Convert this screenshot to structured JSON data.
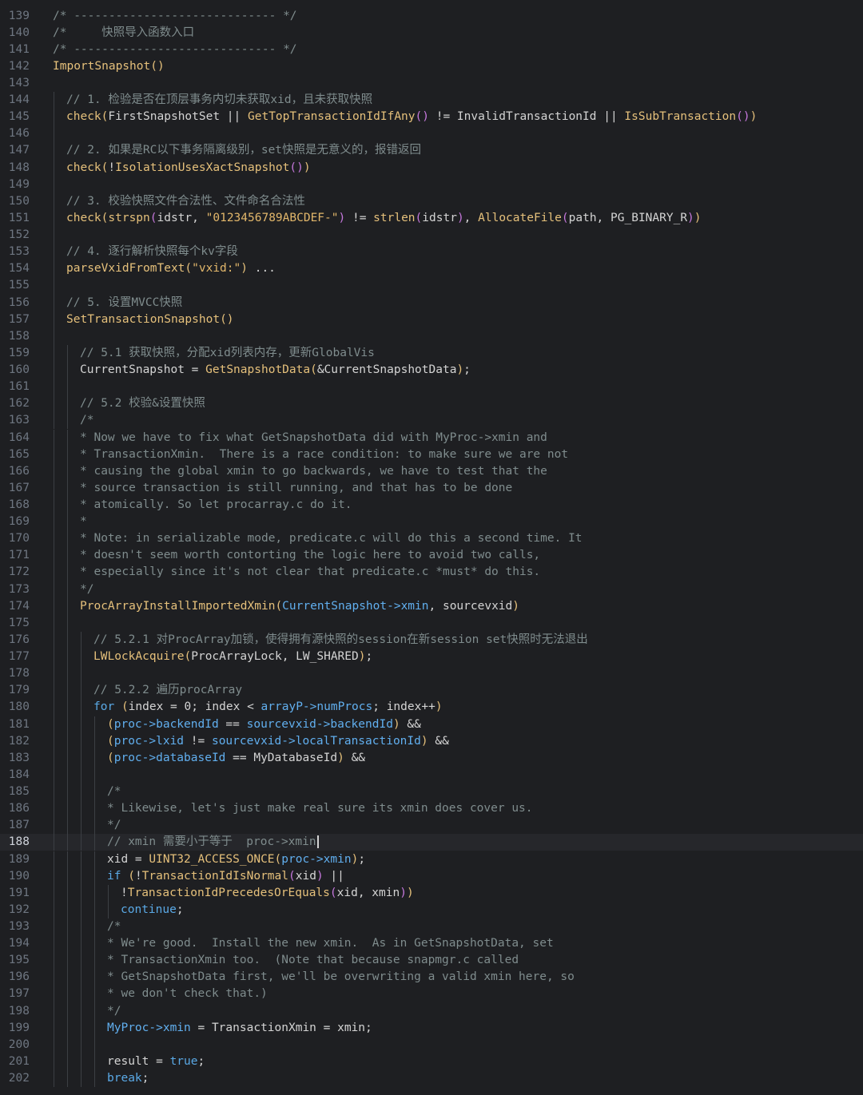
{
  "editor": {
    "current_line": 188,
    "lines": [
      {
        "n": "139",
        "indent": 0,
        "tokens": [
          [
            "cm",
            "/* ----------------------------- */"
          ]
        ]
      },
      {
        "n": "140",
        "indent": 0,
        "tokens": [
          [
            "cm",
            "/*     快照导入函数入口"
          ]
        ]
      },
      {
        "n": "141",
        "indent": 0,
        "tokens": [
          [
            "cm",
            "/* ----------------------------- */"
          ]
        ]
      },
      {
        "n": "142",
        "indent": 0,
        "tokens": [
          [
            "fn",
            "ImportSnapshot"
          ],
          [
            "p1",
            "()"
          ]
        ]
      },
      {
        "n": "143",
        "indent": 0,
        "tokens": []
      },
      {
        "n": "144",
        "indent": 1,
        "tokens": [
          [
            "cm",
            "// 1. 检验是否在顶层事务内切未获取xid，且未获取快照"
          ]
        ]
      },
      {
        "n": "145",
        "indent": 1,
        "tokens": [
          [
            "fn",
            "check"
          ],
          [
            "p1",
            "("
          ],
          [
            "plain",
            "FirstSnapshotSet || "
          ],
          [
            "fn",
            "GetTopTransactionIdIfAny"
          ],
          [
            "p2",
            "()"
          ],
          [
            "plain",
            " != InvalidTransactionId || "
          ],
          [
            "fn",
            "IsSubTransaction"
          ],
          [
            "p2",
            "()"
          ],
          [
            "p1",
            ")"
          ]
        ]
      },
      {
        "n": "146",
        "indent": 1,
        "tokens": []
      },
      {
        "n": "147",
        "indent": 1,
        "tokens": [
          [
            "cm",
            "// 2. 如果是RC以下事务隔离级别，set快照是无意义的，报错返回"
          ]
        ]
      },
      {
        "n": "148",
        "indent": 1,
        "tokens": [
          [
            "fn",
            "check"
          ],
          [
            "p1",
            "("
          ],
          [
            "plain",
            "!"
          ],
          [
            "fn",
            "IsolationUsesXactSnapshot"
          ],
          [
            "p2",
            "()"
          ],
          [
            "p1",
            ")"
          ]
        ]
      },
      {
        "n": "149",
        "indent": 1,
        "tokens": []
      },
      {
        "n": "150",
        "indent": 1,
        "tokens": [
          [
            "cm",
            "// 3. 校验快照文件合法性、文件命名合法性"
          ]
        ]
      },
      {
        "n": "151",
        "indent": 1,
        "tokens": [
          [
            "fn",
            "check"
          ],
          [
            "p1",
            "("
          ],
          [
            "fn",
            "strspn"
          ],
          [
            "p2",
            "("
          ],
          [
            "plain",
            "idstr, "
          ],
          [
            "str",
            "\"0123456789ABCDEF-\""
          ],
          [
            "p2",
            ")"
          ],
          [
            "plain",
            " != "
          ],
          [
            "fn",
            "strlen"
          ],
          [
            "p2",
            "("
          ],
          [
            "plain",
            "idstr"
          ],
          [
            "p2",
            ")"
          ],
          [
            "plain",
            ", "
          ],
          [
            "fn",
            "AllocateFile"
          ],
          [
            "p2",
            "("
          ],
          [
            "plain",
            "path, PG_BINARY_R"
          ],
          [
            "p2",
            ")"
          ],
          [
            "p1",
            ")"
          ]
        ]
      },
      {
        "n": "152",
        "indent": 1,
        "tokens": []
      },
      {
        "n": "153",
        "indent": 1,
        "tokens": [
          [
            "cm",
            "// 4. 逐行解析快照每个kv字段"
          ]
        ]
      },
      {
        "n": "154",
        "indent": 1,
        "tokens": [
          [
            "fn",
            "parseVxidFromText"
          ],
          [
            "p1",
            "("
          ],
          [
            "str",
            "\"vxid:\""
          ],
          [
            "p1",
            ")"
          ],
          [
            "plain",
            " ..."
          ]
        ]
      },
      {
        "n": "155",
        "indent": 1,
        "tokens": []
      },
      {
        "n": "156",
        "indent": 1,
        "tokens": [
          [
            "cm",
            "// 5. 设置MVCC快照"
          ]
        ]
      },
      {
        "n": "157",
        "indent": 1,
        "tokens": [
          [
            "fn",
            "SetTransactionSnapshot"
          ],
          [
            "p1",
            "()"
          ]
        ]
      },
      {
        "n": "158",
        "indent": 1,
        "tokens": []
      },
      {
        "n": "159",
        "indent": 2,
        "tokens": [
          [
            "cm",
            "// 5.1 获取快照，分配xid列表内存，更新GlobalVis"
          ]
        ]
      },
      {
        "n": "160",
        "indent": 2,
        "tokens": [
          [
            "plain",
            "CurrentSnapshot = "
          ],
          [
            "fn",
            "GetSnapshotData"
          ],
          [
            "p1",
            "("
          ],
          [
            "plain",
            "&CurrentSnapshotData"
          ],
          [
            "p1",
            ")"
          ],
          [
            "plain",
            ";"
          ]
        ]
      },
      {
        "n": "161",
        "indent": 2,
        "tokens": []
      },
      {
        "n": "162",
        "indent": 2,
        "tokens": [
          [
            "cm",
            "// 5.2 校验&设置快照"
          ]
        ]
      },
      {
        "n": "163",
        "indent": 2,
        "tokens": [
          [
            "cm",
            "/*"
          ]
        ]
      },
      {
        "n": "164",
        "indent": 2,
        "tokens": [
          [
            "cm",
            "* Now we have to fix what GetSnapshotData did with MyProc->xmin and"
          ]
        ]
      },
      {
        "n": "165",
        "indent": 2,
        "tokens": [
          [
            "cm",
            "* TransactionXmin.  There is a race condition: to make sure we are not"
          ]
        ]
      },
      {
        "n": "166",
        "indent": 2,
        "tokens": [
          [
            "cm",
            "* causing the global xmin to go backwards, we have to test that the"
          ]
        ]
      },
      {
        "n": "167",
        "indent": 2,
        "tokens": [
          [
            "cm",
            "* source transaction is still running, and that has to be done"
          ]
        ]
      },
      {
        "n": "168",
        "indent": 2,
        "tokens": [
          [
            "cm",
            "* atomically. So let procarray.c do it."
          ]
        ]
      },
      {
        "n": "169",
        "indent": 2,
        "tokens": [
          [
            "cm",
            "*"
          ]
        ]
      },
      {
        "n": "170",
        "indent": 2,
        "tokens": [
          [
            "cm",
            "* Note: in serializable mode, predicate.c will do this a second time. It"
          ]
        ]
      },
      {
        "n": "171",
        "indent": 2,
        "tokens": [
          [
            "cm",
            "* doesn't seem worth contorting the logic here to avoid two calls,"
          ]
        ]
      },
      {
        "n": "172",
        "indent": 2,
        "tokens": [
          [
            "cm",
            "* especially since it's not clear that predicate.c *must* do this."
          ]
        ]
      },
      {
        "n": "173",
        "indent": 2,
        "tokens": [
          [
            "cm",
            "*/"
          ]
        ]
      },
      {
        "n": "174",
        "indent": 2,
        "tokens": [
          [
            "fn",
            "ProcArrayInstallImportedXmin"
          ],
          [
            "p1",
            "("
          ],
          [
            "var",
            "CurrentSnapshot->xmin"
          ],
          [
            "plain",
            ", sourcevxid"
          ],
          [
            "p1",
            ")"
          ]
        ]
      },
      {
        "n": "175",
        "indent": 2,
        "tokens": []
      },
      {
        "n": "176",
        "indent": 3,
        "tokens": [
          [
            "cm",
            "// 5.2.1 对ProcArray加锁，使得拥有源快照的session在新session set快照时无法退出"
          ]
        ]
      },
      {
        "n": "177",
        "indent": 3,
        "tokens": [
          [
            "fn",
            "LWLockAcquire"
          ],
          [
            "p1",
            "("
          ],
          [
            "plain",
            "ProcArrayLock, LW_SHARED"
          ],
          [
            "p1",
            ")"
          ],
          [
            "plain",
            ";"
          ]
        ]
      },
      {
        "n": "178",
        "indent": 3,
        "tokens": []
      },
      {
        "n": "179",
        "indent": 3,
        "tokens": [
          [
            "cm",
            "// 5.2.2 遍历procArray"
          ]
        ]
      },
      {
        "n": "180",
        "indent": 3,
        "tokens": [
          [
            "kw",
            "for"
          ],
          [
            "plain",
            " "
          ],
          [
            "p1",
            "("
          ],
          [
            "plain",
            "index = 0; index < "
          ],
          [
            "var",
            "arrayP->numProcs"
          ],
          [
            "plain",
            "; index++"
          ],
          [
            "p1",
            ")"
          ]
        ]
      },
      {
        "n": "181",
        "indent": 4,
        "tokens": [
          [
            "p1",
            "("
          ],
          [
            "var",
            "proc->backendId"
          ],
          [
            "plain",
            " == "
          ],
          [
            "var",
            "sourcevxid->backendId"
          ],
          [
            "p1",
            ")"
          ],
          [
            "plain",
            " &&"
          ]
        ]
      },
      {
        "n": "182",
        "indent": 4,
        "tokens": [
          [
            "p1",
            "("
          ],
          [
            "var",
            "proc->lxid"
          ],
          [
            "plain",
            " != "
          ],
          [
            "var",
            "sourcevxid->localTransactionId"
          ],
          [
            "p1",
            ")"
          ],
          [
            "plain",
            " &&"
          ]
        ]
      },
      {
        "n": "183",
        "indent": 4,
        "tokens": [
          [
            "p1",
            "("
          ],
          [
            "var",
            "proc->databaseId"
          ],
          [
            "plain",
            " == MyDatabaseId"
          ],
          [
            "p1",
            ")"
          ],
          [
            "plain",
            " &&"
          ]
        ]
      },
      {
        "n": "184",
        "indent": 4,
        "tokens": []
      },
      {
        "n": "185",
        "indent": 4,
        "tokens": [
          [
            "cm",
            "/*"
          ]
        ]
      },
      {
        "n": "186",
        "indent": 4,
        "tokens": [
          [
            "cm",
            "* Likewise, let's just make real sure its xmin does cover us."
          ]
        ]
      },
      {
        "n": "187",
        "indent": 4,
        "tokens": [
          [
            "cm",
            "*/"
          ]
        ]
      },
      {
        "n": "188",
        "indent": 4,
        "tokens": [
          [
            "cm",
            "// xmin 需要小于等于  proc->xmin"
          ]
        ]
      },
      {
        "n": "189",
        "indent": 4,
        "tokens": [
          [
            "plain",
            "xid = "
          ],
          [
            "fn",
            "UINT32_ACCESS_ONCE"
          ],
          [
            "p1",
            "("
          ],
          [
            "var",
            "proc->xmin"
          ],
          [
            "p1",
            ")"
          ],
          [
            "plain",
            ";"
          ]
        ]
      },
      {
        "n": "190",
        "indent": 4,
        "tokens": [
          [
            "kw",
            "if"
          ],
          [
            "plain",
            " "
          ],
          [
            "p1",
            "("
          ],
          [
            "plain",
            "!"
          ],
          [
            "fn",
            "TransactionIdIsNormal"
          ],
          [
            "p2",
            "("
          ],
          [
            "plain",
            "xid"
          ],
          [
            "p2",
            ")"
          ],
          [
            "plain",
            " ||"
          ]
        ]
      },
      {
        "n": "191",
        "indent": 5,
        "tokens": [
          [
            "plain",
            "!"
          ],
          [
            "fn",
            "TransactionIdPrecedesOrEquals"
          ],
          [
            "p2",
            "("
          ],
          [
            "plain",
            "xid, xmin"
          ],
          [
            "p2",
            ")"
          ],
          [
            "p1",
            ")"
          ]
        ]
      },
      {
        "n": "192",
        "indent": 5,
        "tokens": [
          [
            "kw",
            "continue"
          ],
          [
            "plain",
            ";"
          ]
        ]
      },
      {
        "n": "193",
        "indent": 4,
        "tokens": [
          [
            "cm",
            "/*"
          ]
        ]
      },
      {
        "n": "194",
        "indent": 4,
        "tokens": [
          [
            "cm",
            "* We're good.  Install the new xmin.  As in GetSnapshotData, set"
          ]
        ]
      },
      {
        "n": "195",
        "indent": 4,
        "tokens": [
          [
            "cm",
            "* TransactionXmin too.  (Note that because snapmgr.c called"
          ]
        ]
      },
      {
        "n": "196",
        "indent": 4,
        "tokens": [
          [
            "cm",
            "* GetSnapshotData first, we'll be overwriting a valid xmin here, so"
          ]
        ]
      },
      {
        "n": "197",
        "indent": 4,
        "tokens": [
          [
            "cm",
            "* we don't check that.)"
          ]
        ]
      },
      {
        "n": "198",
        "indent": 4,
        "tokens": [
          [
            "cm",
            "*/"
          ]
        ]
      },
      {
        "n": "199",
        "indent": 4,
        "tokens": [
          [
            "var",
            "MyProc->xmin"
          ],
          [
            "plain",
            " = TransactionXmin = xmin;"
          ]
        ]
      },
      {
        "n": "200",
        "indent": 4,
        "tokens": []
      },
      {
        "n": "201",
        "indent": 4,
        "tokens": [
          [
            "plain",
            "result = "
          ],
          [
            "kw",
            "true"
          ],
          [
            "plain",
            ";"
          ]
        ]
      },
      {
        "n": "202",
        "indent": 4,
        "tokens": [
          [
            "kw",
            "break"
          ],
          [
            "plain",
            ";"
          ]
        ]
      }
    ]
  }
}
